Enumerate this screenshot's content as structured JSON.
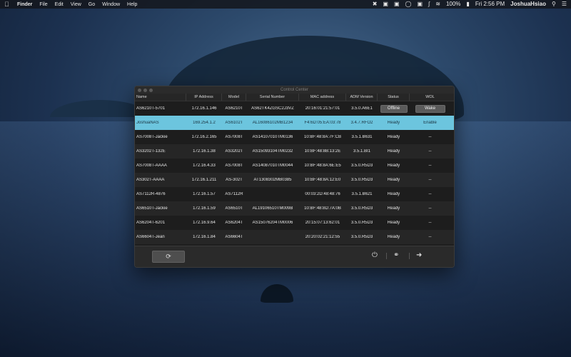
{
  "menubar": {
    "app": "Finder",
    "items": [
      "File",
      "Edit",
      "View",
      "Go",
      "Window",
      "Help"
    ],
    "battery": "100%",
    "clock": "Fri 2:56 PM",
    "user": "JoshuaHsiao"
  },
  "window": {
    "title": "Control Center",
    "columns": [
      "Name",
      "IP Address",
      "Model",
      "Serial Number",
      "MAC address",
      "ADM Version",
      "Status",
      "WOL"
    ],
    "rows": [
      {
        "name": "AS6210T-5701",
        "ip": "172.16.1.146",
        "model": "AS6210T",
        "serial": "AS62TK4ZGSC2J3VZ",
        "mac": "20:16:01:21:57:01",
        "adm": "3.5.0.A6E1",
        "status": "Offline",
        "wol": "Wake"
      },
      {
        "name": "JoshuaNAS",
        "ip": "169.254.1.2",
        "model": "AS6102T",
        "serial": "AL16086102MB1234",
        "mac": "F4:6D:05:EA:03:78",
        "adm": "3.4.7.RFO2",
        "status": "Ready",
        "wol": "Enable"
      },
      {
        "name": "AS7008T-Jackie",
        "ip": "172.16.2.165",
        "model": "AS7008T",
        "serial": "AS14107010TM0136",
        "mac": "10:BF:48:8A:7F:CB",
        "adm": "3.5.1.B631",
        "status": "Ready",
        "wol": "--"
      },
      {
        "name": "AS3202T-132E",
        "ip": "172.16.1.38",
        "model": "AS3202T",
        "serial": "AS15093104TM0232",
        "mac": "10:BF:48:8B:13:2E",
        "adm": "3.5.1.BI1",
        "status": "Ready",
        "wol": "--"
      },
      {
        "name": "AS7008T-AAAA",
        "ip": "172.16.4.33",
        "model": "AS7008T",
        "serial": "AS14087010TM0044",
        "mac": "10:BF:48:8A:6E:E5",
        "adm": "3.5.0.R5D3",
        "status": "Ready",
        "wol": "--"
      },
      {
        "name": "AS302T-AAAA",
        "ip": "172.16.1.211",
        "model": "AS-302T",
        "serial": "AT1308302MB0385",
        "mac": "10:BF:48:8A:12:E0",
        "adm": "3.5.0.R5D3",
        "status": "Ready",
        "wol": "--"
      },
      {
        "name": "AS7112R-4876",
        "ip": "172.16.1.57",
        "model": "AS7112R",
        "serial": "",
        "mac": "00:03:2D:48:48:76",
        "adm": "3.5.1.B621",
        "status": "Ready",
        "wol": "--"
      },
      {
        "name": "AS6510T-Jackie",
        "ip": "172.16.1.59",
        "model": "AS6510T",
        "serial": "AL19106510TM009B",
        "mac": "10:BF:48:8D:7A:0B",
        "adm": "3.5.0.R5D3",
        "status": "Ready",
        "wol": "--"
      },
      {
        "name": "AS6204T-6201",
        "ip": "172.16.9.64",
        "model": "AS6204T",
        "serial": "AS15076204TM0006",
        "mac": "20:15:07:13:62:01",
        "adm": "3.5.0.R5D3",
        "status": "Ready",
        "wol": "--"
      },
      {
        "name": "AS6604T-Jean",
        "ip": "172.16.1.84",
        "model": "AS6604T",
        "serial": "",
        "mac": "20:20:02:21:12:55",
        "adm": "3.5.0.R5D3",
        "status": "Ready",
        "wol": "--"
      }
    ],
    "selected_row": 1
  },
  "footer": {
    "refresh_icon": "refresh-icon",
    "power_icon": "power-icon",
    "link_icon": "link-icon",
    "login_icon": "arrow-right-icon"
  },
  "colors": {
    "selected_row": "#6cc5de",
    "window_bg": "#1e1e1e"
  }
}
